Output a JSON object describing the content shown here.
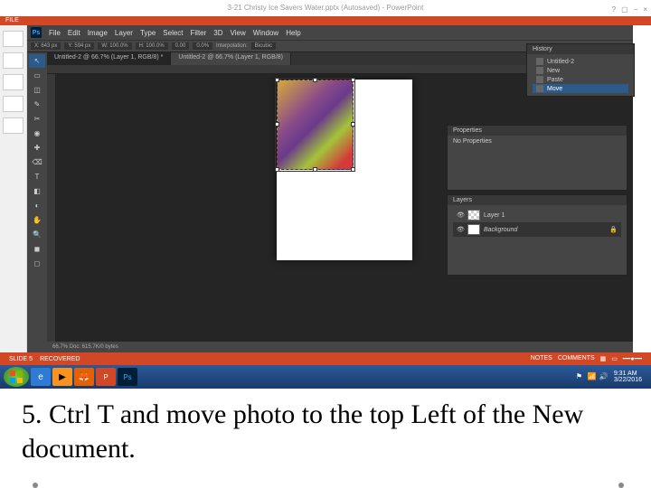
{
  "powerpoint": {
    "title": "3-21 Christy Ice Savers Water.pptx (Autosaved) - PowerPoint",
    "file_tab": "FILE",
    "status": {
      "slide": "SLIDE 5",
      "recovered": "RECOVERED",
      "notes": "NOTES",
      "comments": "COMMENTS"
    }
  },
  "photoshop": {
    "logo": "Ps",
    "menu": [
      "File",
      "Edit",
      "Image",
      "Layer",
      "Type",
      "Select",
      "Filter",
      "3D",
      "View",
      "Window",
      "Help"
    ],
    "options": {
      "x": "X: 643 px",
      "y": "Y: 594 px",
      "w": "W: 100.0%",
      "h": "H: 100.0%",
      "angle": "0.00",
      "interp": "0.0%",
      "interp2": "Interpolation:",
      "bicubic": "Bicubic"
    },
    "tabs": [
      "Untitled-2 @ 66.7% (Layer 1, RGB/8) *",
      "Untitled-2 @ 66.7% (Layer 1, RGB/8)"
    ],
    "status": "66.7%   Doc: 615.7K/0 bytes",
    "history": {
      "title": "History",
      "items": [
        "Untitled-2",
        "New",
        "Paste",
        "Move"
      ],
      "active_idx": 3
    },
    "properties": {
      "title": "Properties",
      "text": "No Properties"
    },
    "layers": {
      "title": "Layers",
      "items": [
        "Layer 1",
        "Background"
      ]
    },
    "tools": [
      "↖",
      "▭",
      "◫",
      "✎",
      "✂",
      "◉",
      "✚",
      "⌫",
      "T",
      "◧",
      "◐",
      "✋",
      "🔍",
      "◼",
      "◻"
    ]
  },
  "taskbar": {
    "time": "9:31 AM",
    "date": "3/22/2016"
  },
  "caption": "5. Ctrl T and move photo to the top Left of the New document."
}
